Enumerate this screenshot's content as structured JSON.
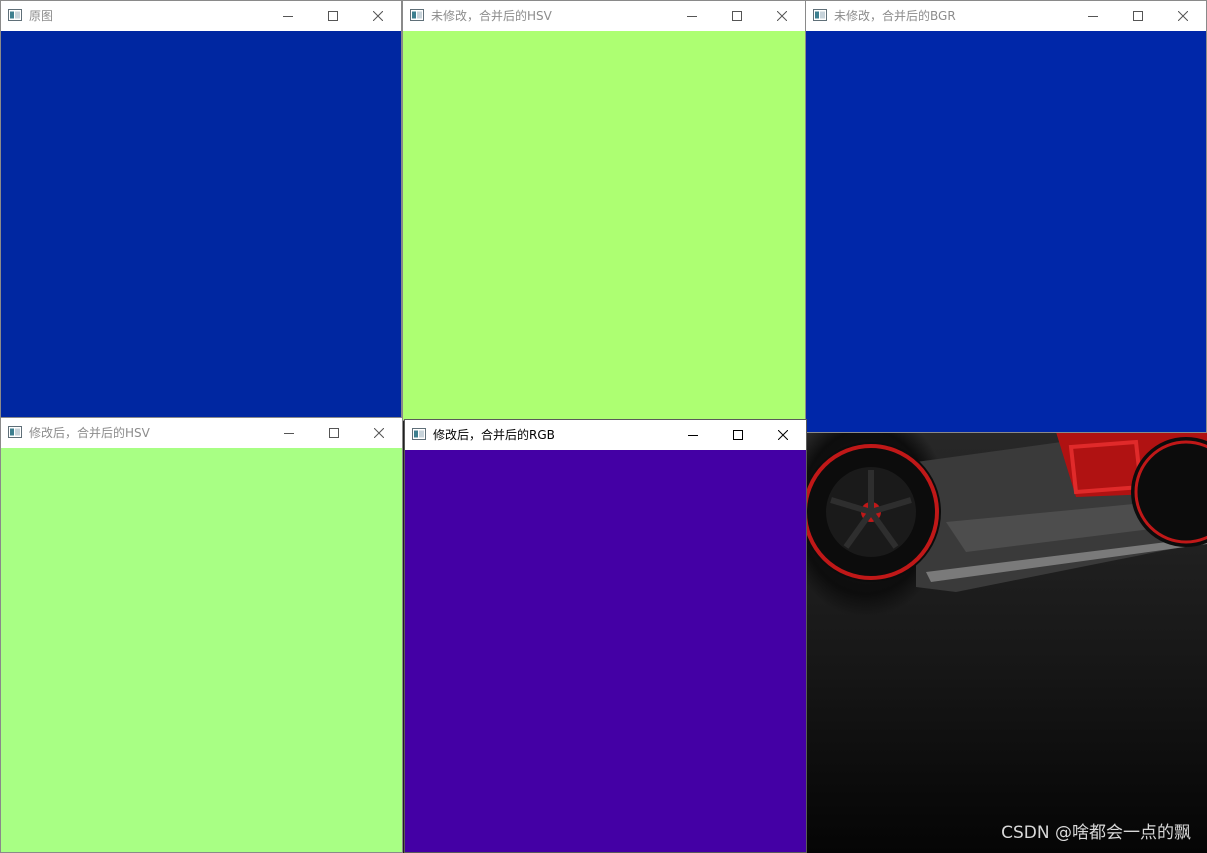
{
  "windows": {
    "original": {
      "title": "原图",
      "color": "#0027a1"
    },
    "unmodified_hsv": {
      "title": "未修改，合并后的HSV",
      "color": "#adff72"
    },
    "unmodified_bgr": {
      "title": "未修改，合并后的BGR",
      "color": "#0027a9"
    },
    "modified_hsv": {
      "title": "修改后，合并后的HSV",
      "color": "#a8ff84"
    },
    "modified_rgb": {
      "title": "修改后，合并后的RGB",
      "color": "#4400a5"
    }
  },
  "caption_buttons": {
    "minimize": "minimize-icon",
    "maximize": "maximize-icon",
    "close": "close-icon"
  },
  "background_photo": {
    "description_icon": "car-photo",
    "watermark": "CSDN @啥都会一点的​飘"
  }
}
